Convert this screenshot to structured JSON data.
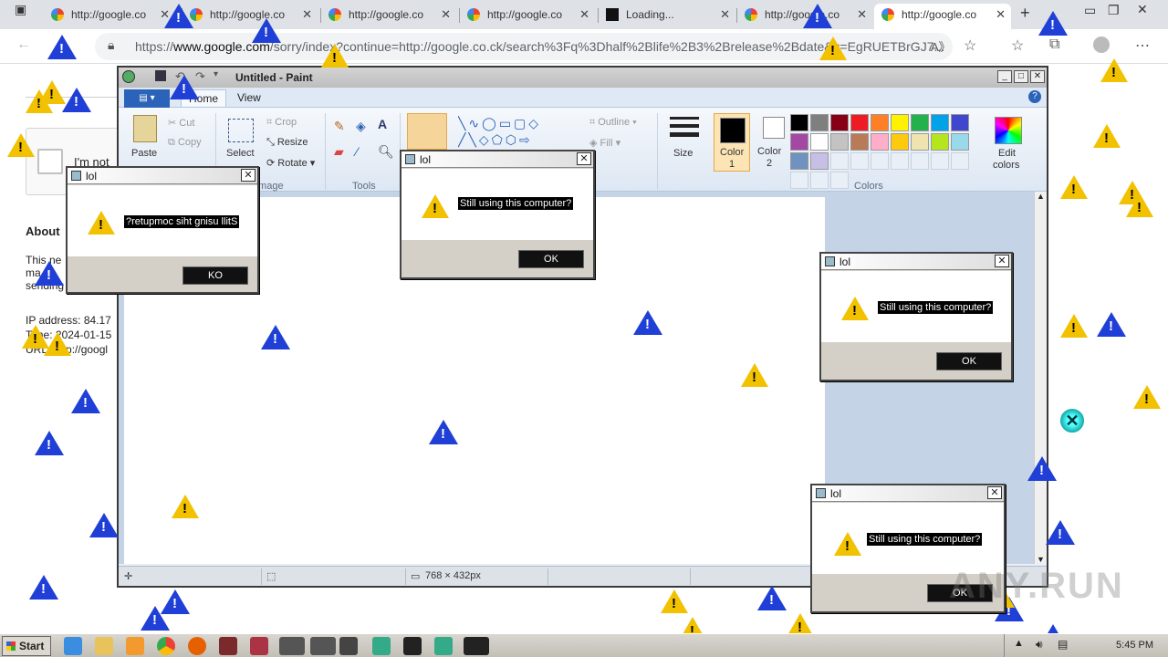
{
  "browser": {
    "tabs": [
      {
        "title": "http://google.co",
        "favicon": "google-icon",
        "active": false
      },
      {
        "title": "http://google.co",
        "favicon": "google-icon",
        "active": false
      },
      {
        "title": "http://google.co",
        "favicon": "google-icon",
        "active": false
      },
      {
        "title": "http://google.co",
        "favicon": "google-icon",
        "active": false
      },
      {
        "title": "Loading...",
        "favicon": "black-square-icon",
        "active": false
      },
      {
        "title": "http://google.co",
        "favicon": "google-icon",
        "active": false
      },
      {
        "title": "http://google.co",
        "favicon": "google-icon",
        "active": true
      }
    ],
    "url_prefix": "https://",
    "url_domain": "www.google.com",
    "url_rest": "/sorry/index?continue=http://google.co.ck/search%3Fq%3Dhalf%2Blife%2B3%2Brelease%2Bdate&q=EgRUETBrGJ7..."
  },
  "google_page": {
    "captcha_label": "I'm not",
    "about_heading": "About",
    "line1": "This ne",
    "line2": "ma",
    "line3": "sending",
    "ip": "IP address: 84.17",
    "time": "Time: 2024-01-15",
    "url": "URL: http://googl"
  },
  "paint": {
    "title": "Untitled - Paint",
    "tab_home": "Home",
    "tab_view": "View",
    "clipboard": {
      "paste": "Paste",
      "cut": "Cut",
      "copy": "Copy",
      "group": "Clipboard"
    },
    "image": {
      "select": "Select",
      "crop": "Crop",
      "resize": "Resize",
      "rotate": "Rotate",
      "group": "Image"
    },
    "tools_group": "Tools",
    "shapes": {
      "outline": "Outline",
      "fill": "Fill"
    },
    "size": "Size",
    "color1": "Color\n1",
    "color1_a": "Color",
    "color1_b": "1",
    "color2_a": "Color",
    "color2_b": "2",
    "colors_group": "Colors",
    "edit_colors_a": "Edit",
    "edit_colors_b": "colors",
    "status_dims": "768 × 432px",
    "palette": [
      "#000000",
      "#7f7f7f",
      "#880015",
      "#ed1c24",
      "#ff7f27",
      "#fff200",
      "#22b14c",
      "#00a2e8",
      "#3f48cc",
      "#a349a4",
      "#ffffff",
      "#c3c3c3",
      "#b97a57",
      "#ffaec9",
      "#ffc90e",
      "#efe4b0",
      "#b5e61d",
      "#99d9ea",
      "#7092be",
      "#c8bfe7"
    ]
  },
  "dialogs": [
    {
      "title": "lol",
      "message": "?retupmoc siht gnisu llitS",
      "button": "KO"
    },
    {
      "title": "lol",
      "message": "Still using this computer?",
      "button": "OK"
    },
    {
      "title": "lol",
      "message": "Still using this computer?",
      "button": "OK"
    },
    {
      "title": "lol",
      "message": "Still using this computer?",
      "button": "OK"
    }
  ],
  "taskbar": {
    "start": "Start",
    "clock": "5:45 PM"
  },
  "watermark": "ANY.RUN"
}
